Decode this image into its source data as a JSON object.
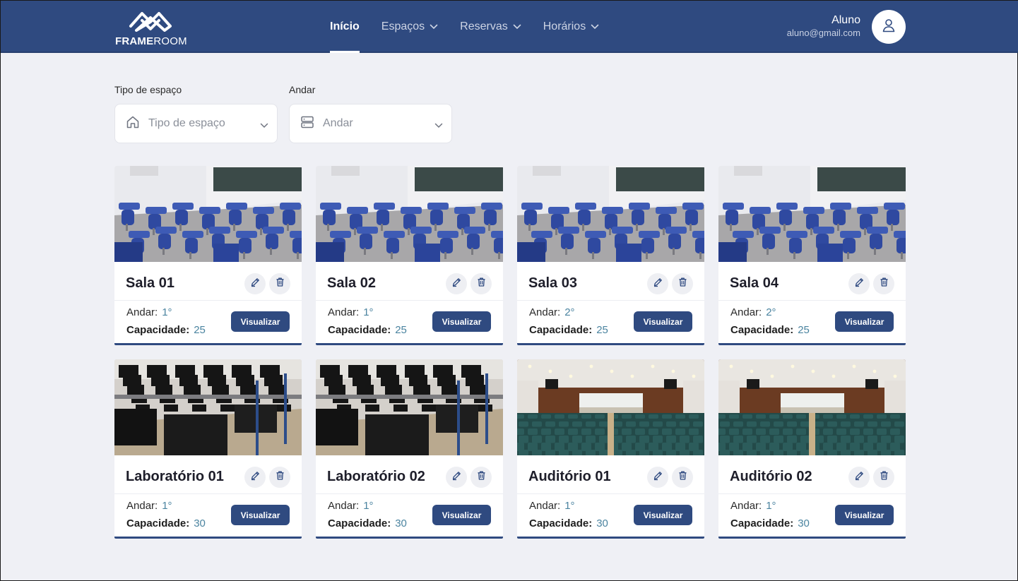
{
  "app": {
    "logo_bold": "FRAME",
    "logo_light": "ROOM"
  },
  "nav": {
    "items": [
      {
        "label": "Início",
        "active": true,
        "dropdown": false
      },
      {
        "label": "Espaços",
        "active": false,
        "dropdown": true
      },
      {
        "label": "Reservas",
        "active": false,
        "dropdown": true
      },
      {
        "label": "Horários",
        "active": false,
        "dropdown": true
      }
    ]
  },
  "user": {
    "name": "Aluno",
    "email": "aluno@gmail.com",
    "icon": "user-icon"
  },
  "filters": {
    "tipo": {
      "label": "Tipo de espaço",
      "placeholder": "Tipo de espaço",
      "icon": "home-icon"
    },
    "andar": {
      "label": "Andar",
      "placeholder": "Andar",
      "icon": "server-icon"
    }
  },
  "card_labels": {
    "andar": "Andar:",
    "capacidade": "Capacidade:",
    "view_button": "Visualizar"
  },
  "rooms": [
    {
      "name": "Sala 01",
      "andar": "1°",
      "capacidade": "25",
      "photo": "classroom"
    },
    {
      "name": "Sala 02",
      "andar": "1°",
      "capacidade": "25",
      "photo": "classroom"
    },
    {
      "name": "Sala 03",
      "andar": "2°",
      "capacidade": "25",
      "photo": "classroom"
    },
    {
      "name": "Sala 04",
      "andar": "2°",
      "capacidade": "25",
      "photo": "classroom"
    },
    {
      "name": "Laboratório 01",
      "andar": "1°",
      "capacidade": "30",
      "photo": "computer-lab"
    },
    {
      "name": "Laboratório 02",
      "andar": "1°",
      "capacidade": "30",
      "photo": "computer-lab"
    },
    {
      "name": "Auditório 01",
      "andar": "1°",
      "capacidade": "30",
      "photo": "auditorium"
    },
    {
      "name": "Auditório 02",
      "andar": "1°",
      "capacidade": "30",
      "photo": "auditorium"
    }
  ],
  "colors": {
    "primary": "#2f4a80",
    "background": "#eff0f5",
    "value_text": "#4b84a0"
  }
}
